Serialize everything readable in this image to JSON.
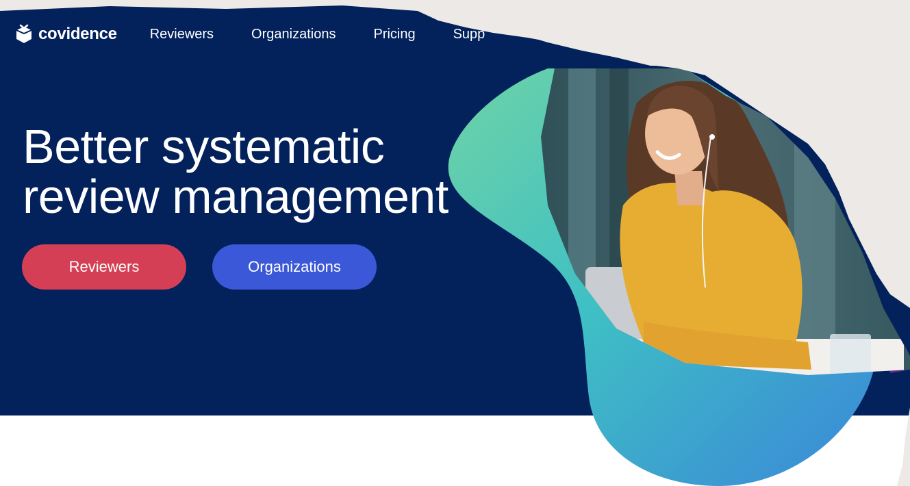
{
  "brand": {
    "name": "covidence",
    "icon": "box-logo-icon"
  },
  "nav": {
    "items": [
      "Reviewers",
      "Organizations",
      "Pricing",
      "Supp"
    ]
  },
  "hero": {
    "headline_line1": "Better systematic",
    "headline_line2": "review management",
    "buttons": {
      "reviewers": "Reviewers",
      "organizations": "Organizations"
    }
  },
  "colors": {
    "navy": "#03215b",
    "red_button": "#d53f55",
    "blue_button": "#3b58d8",
    "teal": "#4cc9b0",
    "purple": "#6a2a8a",
    "torn_paper": "#ece9e6"
  }
}
